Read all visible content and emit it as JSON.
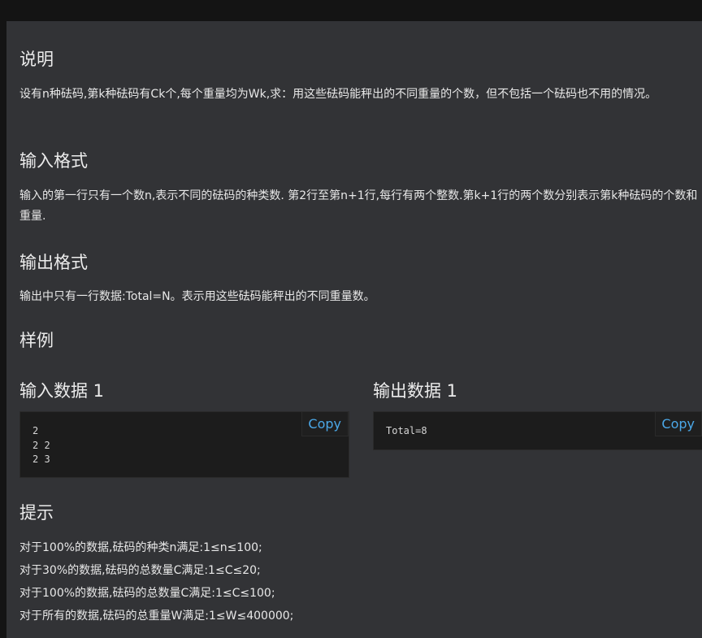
{
  "description": {
    "heading": "说明",
    "text": "设有n种砝码,第k种砝码有Ck个,每个重量均为Wk,求：用这些砝码能秤出的不同重量的个数，但不包括一个砝码也不用的情况。"
  },
  "input_format": {
    "heading": "输入格式",
    "text": "输入的第一行只有一个数n,表示不同的砝码的种类数. 第2行至第n+1行,每行有两个整数.第k+1行的两个数分别表示第k种砝码的个数和重量."
  },
  "output_format": {
    "heading": "输出格式",
    "text": "输出中只有一行数据:Total=N。表示用这些砝码能秤出的不同重量数。"
  },
  "samples": {
    "heading": "样例",
    "input": {
      "title": "输入数据 1",
      "code": "2\n2 2\n2 3",
      "copy_label": "Copy"
    },
    "output": {
      "title": "输出数据 1",
      "code": "Total=8",
      "copy_label": "Copy"
    }
  },
  "hint": {
    "heading": "提示",
    "lines": [
      "对于100%的数据,砝码的种类n满足:1≤n≤100;",
      "对于30%的数据,砝码的总数量C满足:1≤C≤20;",
      "对于100%的数据,砝码的总数量C满足:1≤C≤100;",
      "对于所有的数据,砝码的总重量W满足:1≤W≤400000;"
    ]
  },
  "colors": {
    "background": "#141414",
    "panel": "#323336",
    "code_background": "#1c1c1c",
    "copy_link": "#4ba8e8"
  }
}
